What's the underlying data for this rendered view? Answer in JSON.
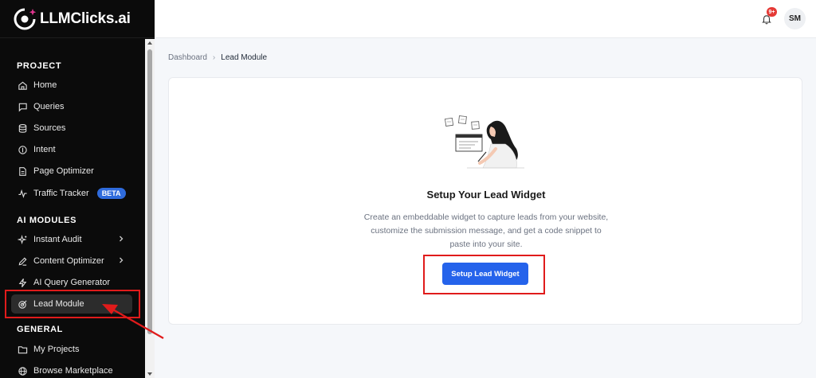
{
  "app": {
    "logo_text": "LLMClicks.ai"
  },
  "sidebar": {
    "sections": [
      {
        "title": "PROJECT",
        "items": [
          {
            "label": "Home",
            "icon": "home-icon"
          },
          {
            "label": "Queries",
            "icon": "chat-icon"
          },
          {
            "label": "Sources",
            "icon": "database-icon"
          },
          {
            "label": "Intent",
            "icon": "compass-icon"
          },
          {
            "label": "Page Optimizer",
            "icon": "document-icon"
          },
          {
            "label": "Traffic Tracker",
            "icon": "activity-icon",
            "badge": "BETA"
          }
        ]
      },
      {
        "title": "AI MODULES",
        "items": [
          {
            "label": "Instant Audit",
            "icon": "sparkles-icon",
            "has_submenu": true
          },
          {
            "label": "Content Optimizer",
            "icon": "pen-icon",
            "has_submenu": true
          },
          {
            "label": "AI Query Generator",
            "icon": "bolt-icon"
          },
          {
            "label": "Lead Module",
            "icon": "target-icon",
            "active": true
          }
        ]
      },
      {
        "title": "GENERAL",
        "items": [
          {
            "label": "My Projects",
            "icon": "folder-icon"
          },
          {
            "label": "Browse Marketplace",
            "icon": "globe-icon"
          }
        ]
      }
    ]
  },
  "header": {
    "notification_count": "9+",
    "avatar_initials": "SM"
  },
  "breadcrumb": {
    "items": [
      "Dashboard",
      "Lead Module"
    ]
  },
  "empty_state": {
    "title": "Setup Your Lead Widget",
    "description": "Create an embeddable widget to capture leads from your website, customize the submission message, and get a code snippet to paste into your site.",
    "button_label": "Setup Lead Widget"
  },
  "colors": {
    "sidebar_bg": "#0b0b0b",
    "accent": "#2563eb",
    "beta_badge": "#2f6bdc",
    "annotation": "#e01b1b"
  }
}
